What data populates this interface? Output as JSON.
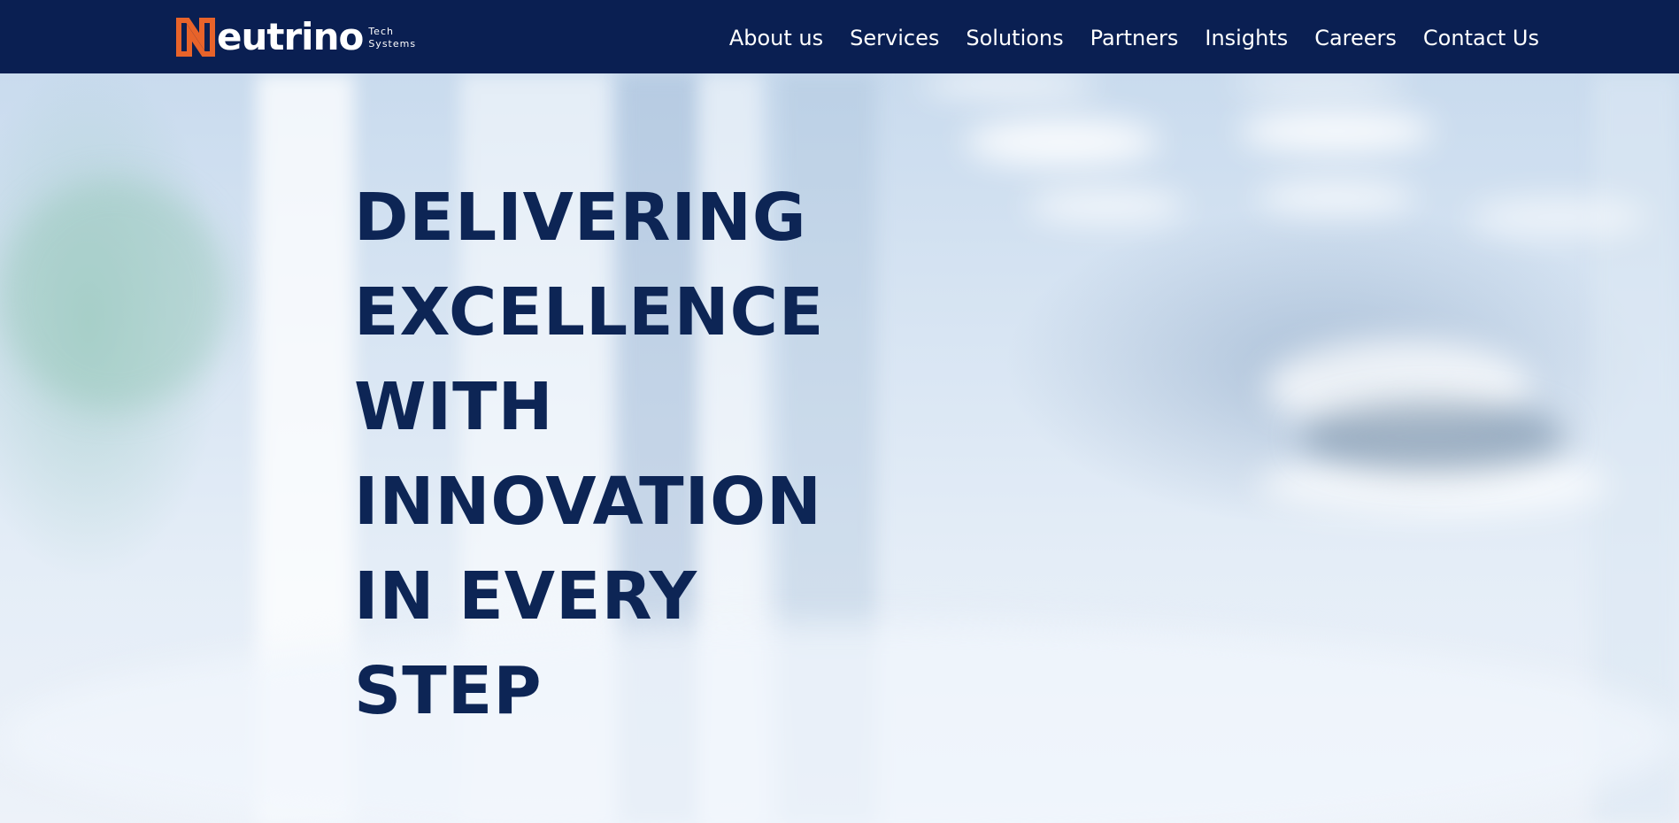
{
  "brand": {
    "logo_word": "eutrino",
    "logo_sub_line1": "Tech",
    "logo_sub_line2": "Systems",
    "accent_color": "#e8632a",
    "header_bg": "#0a1f52"
  },
  "nav": {
    "items": [
      {
        "label": "About us"
      },
      {
        "label": "Services"
      },
      {
        "label": "Solutions"
      },
      {
        "label": "Partners"
      },
      {
        "label": "Insights"
      },
      {
        "label": "Careers"
      },
      {
        "label": "Contact Us"
      }
    ]
  },
  "hero": {
    "headline_lines": [
      "DELIVERING",
      "EXCELLENCE",
      "WITH",
      "INNOVATION",
      "IN EVERY",
      "STEP"
    ],
    "headline_color": "#0d2555"
  }
}
